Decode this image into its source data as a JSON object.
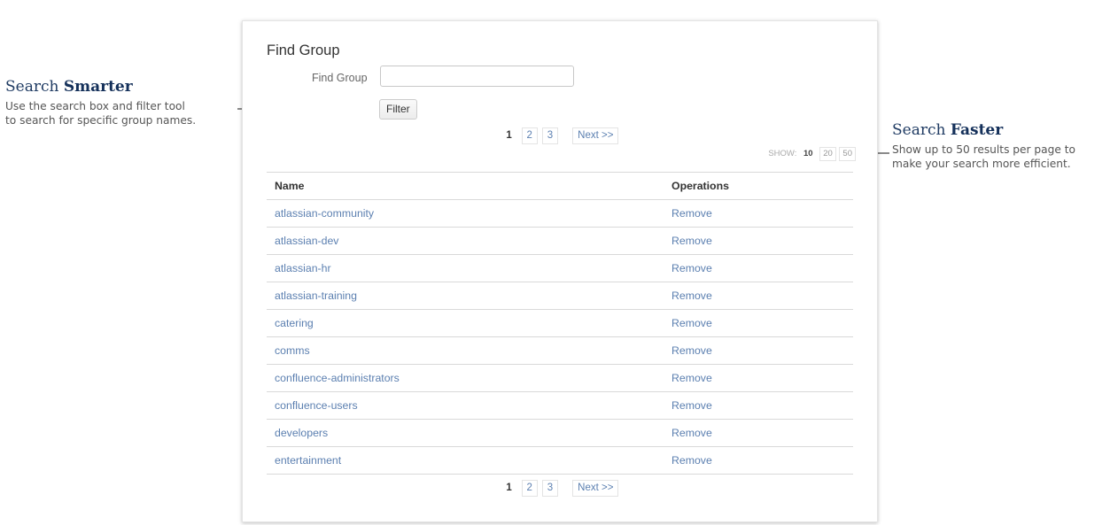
{
  "callouts": {
    "left": {
      "title_plain": "Search ",
      "title_bold": "Smarter",
      "line1": "Use the search box and filter tool",
      "line2": "to search for specific group names."
    },
    "right": {
      "title_plain": "Search ",
      "title_bold": "Faster",
      "line1": "Show up to 50 results per page to",
      "line2": "make your search more efficient."
    }
  },
  "panel": {
    "title": "Find Group",
    "find_label": "Find Group",
    "find_value": "",
    "filter_label": "Filter"
  },
  "pagination": {
    "pages": [
      "1",
      "2",
      "3"
    ],
    "current": "1",
    "next_label": "Next >>"
  },
  "show": {
    "label": "SHOW:",
    "options": [
      "10",
      "20",
      "50"
    ],
    "current": "10"
  },
  "table": {
    "headers": {
      "name": "Name",
      "operations": "Operations"
    },
    "rows": [
      {
        "name": "atlassian-community",
        "op": "Remove"
      },
      {
        "name": "atlassian-dev",
        "op": "Remove"
      },
      {
        "name": "atlassian-hr",
        "op": "Remove"
      },
      {
        "name": "atlassian-training",
        "op": "Remove"
      },
      {
        "name": "catering",
        "op": "Remove"
      },
      {
        "name": "comms",
        "op": "Remove"
      },
      {
        "name": "confluence-administrators",
        "op": "Remove"
      },
      {
        "name": "confluence-users",
        "op": "Remove"
      },
      {
        "name": "developers",
        "op": "Remove"
      },
      {
        "name": "entertainment",
        "op": "Remove"
      }
    ]
  },
  "colors": {
    "link": "#5b7fb0",
    "callout_title": "#1f3b63",
    "arrow": "#8a8a8a"
  }
}
